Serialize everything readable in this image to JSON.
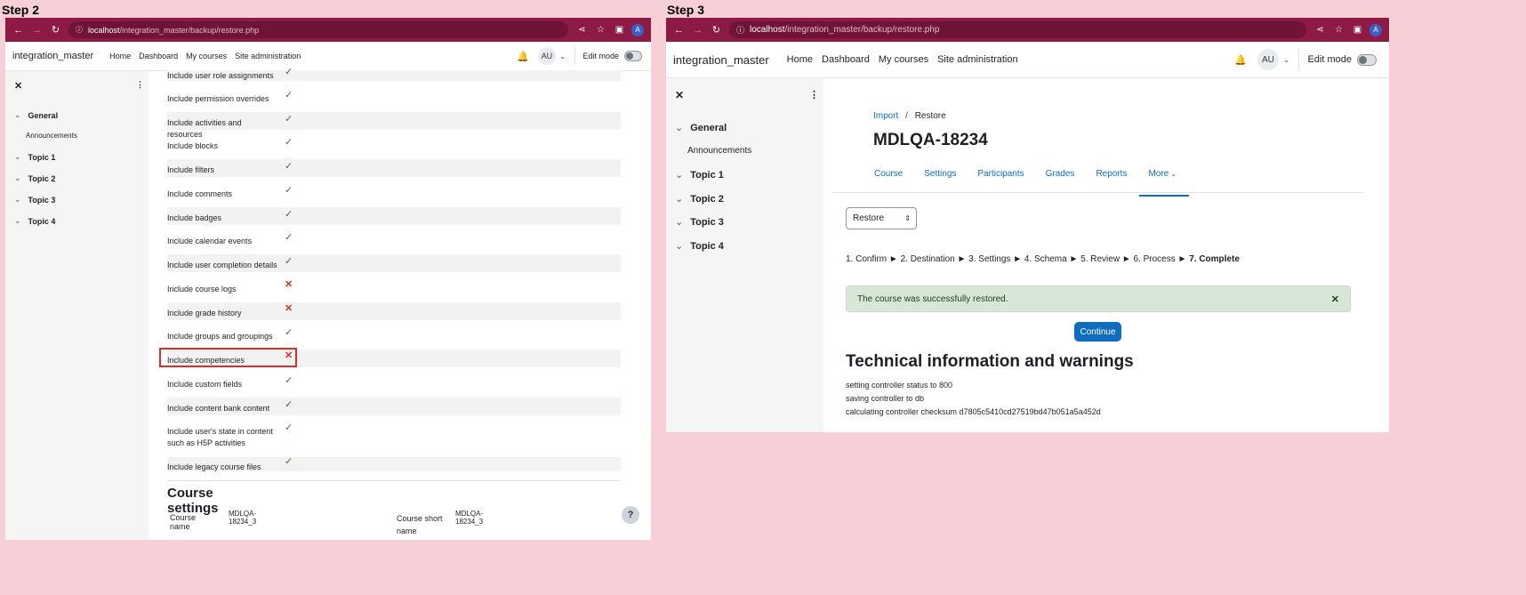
{
  "step2": {
    "label": "Step 2",
    "browser": {
      "url_host": "localhost",
      "url_path": "/integration_master/backup/restore.php",
      "profile_initial": "A"
    },
    "navbar": {
      "brand": "integration_master",
      "links": [
        "Home",
        "Dashboard",
        "My courses",
        "Site administration"
      ],
      "avatar": "AU",
      "edit_mode": "Edit mode"
    },
    "drawer": {
      "sections": [
        "General",
        "Topic 1",
        "Topic 2",
        "Topic 3",
        "Topic 4"
      ],
      "sub_item": "Announcements"
    },
    "settings_rows": [
      {
        "label": "Include user role assignments",
        "enabled": true
      },
      {
        "label": "Include permission overrides",
        "enabled": true
      },
      {
        "label": "Include activities and resources",
        "enabled": true
      },
      {
        "label": "Include blocks",
        "enabled": true
      },
      {
        "label": "Include filters",
        "enabled": true
      },
      {
        "label": "Include comments",
        "enabled": true
      },
      {
        "label": "Include badges",
        "enabled": true
      },
      {
        "label": "Include calendar events",
        "enabled": true
      },
      {
        "label": "Include user completion details",
        "enabled": true
      },
      {
        "label": "Include course logs",
        "enabled": false
      },
      {
        "label": "Include grade history",
        "enabled": false
      },
      {
        "label": "Include groups and groupings",
        "enabled": true
      },
      {
        "label": "Include competencies",
        "enabled": false
      },
      {
        "label": "Include custom fields",
        "enabled": true
      },
      {
        "label": "Include content bank content",
        "enabled": true
      },
      {
        "label": "Include user's state in content such as H5P activities",
        "enabled": true
      },
      {
        "label": "Include legacy course files",
        "enabled": true
      }
    ],
    "course_settings": {
      "heading": "Course settings",
      "course_name_label": "Course name",
      "course_name_value": "MDLQA-18234_3",
      "course_short_name_label": "Course short name",
      "course_short_name_value": "MDLQA-18234_3"
    },
    "help": "?"
  },
  "step3": {
    "label": "Step 3",
    "browser": {
      "url_host": "localhost",
      "url_path": "/integration_master/backup/restore.php",
      "profile_initial": "A"
    },
    "navbar": {
      "brand": "integration_master",
      "links": [
        "Home",
        "Dashboard",
        "My courses",
        "Site administration"
      ],
      "avatar": "AU",
      "edit_mode": "Edit mode"
    },
    "drawer": {
      "sections": [
        "General",
        "Topic 1",
        "Topic 2",
        "Topic 3",
        "Topic 4"
      ],
      "sub_item": "Announcements"
    },
    "breadcrumb": {
      "import": "Import",
      "separator": "/",
      "current": "Restore"
    },
    "course_title": "MDLQA-18234",
    "tabs": [
      "Course",
      "Settings",
      "Participants",
      "Grades",
      "Reports",
      "More"
    ],
    "select_value": "Restore",
    "progress": {
      "steps": "1. Confirm ► 2. Destination ► 3. Settings ► 4. Schema ► 5. Review ► 6. Process ►",
      "current": "7. Complete"
    },
    "alert": "The course was successfully restored.",
    "continue_button": "Continue",
    "tech_heading": "Technical information and warnings",
    "tech_lines": [
      "setting controller status to 800",
      "saving controller to db",
      "calculating controller checksum d7805c5410cd27519bd47b051a5a452d"
    ]
  }
}
